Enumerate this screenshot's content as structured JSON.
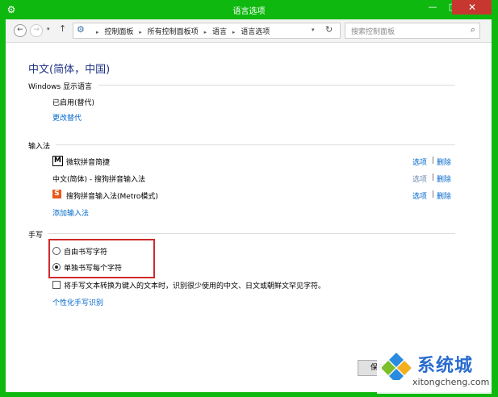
{
  "window": {
    "title": "语言选项"
  },
  "titlebar": {
    "min": "—",
    "max": "□",
    "close": "✕"
  },
  "nav": {
    "back": "←",
    "forward": "→",
    "dropdown": "▾",
    "up": "↑",
    "breadcrumbs": [
      "控制面板",
      "所有控制面板项",
      "语言",
      "语言选项"
    ],
    "refresh": "↻",
    "search_placeholder": "搜索控制面板"
  },
  "page": {
    "title": "中文(简体，中国)"
  },
  "windows_display_language": {
    "header": "Windows 显示语言",
    "status": "已启用(替代)",
    "change_link": "更改替代"
  },
  "input_methods": {
    "header": "输入法",
    "items": [
      {
        "name": "微软拼音简捷",
        "icon": "M",
        "options": "选项",
        "sep": "|",
        "delete": "删除"
      },
      {
        "name": "中文(简体) - 搜狗拼音输入法",
        "icon": "",
        "options": "选项",
        "sep": "|",
        "delete": "删除"
      },
      {
        "name": "搜狗拼音输入法(Metro模式)",
        "icon": "S",
        "options": "选项",
        "sep": "|",
        "delete": "删除"
      }
    ],
    "add_link": "添加输入法"
  },
  "handwriting": {
    "header": "手写",
    "radio_freeform": "自由书写字符",
    "radio_single": "单独书写每个字符",
    "checkbox_label": "将手写文本转换为键入的文本时，识别很少使用的中文、日文或朝鲜文罕见字符。",
    "personalize_link": "个性化手写识别"
  },
  "footer": {
    "save": "保存"
  },
  "watermark": {
    "brand": "系统城",
    "url": "xitongcheng.com"
  }
}
